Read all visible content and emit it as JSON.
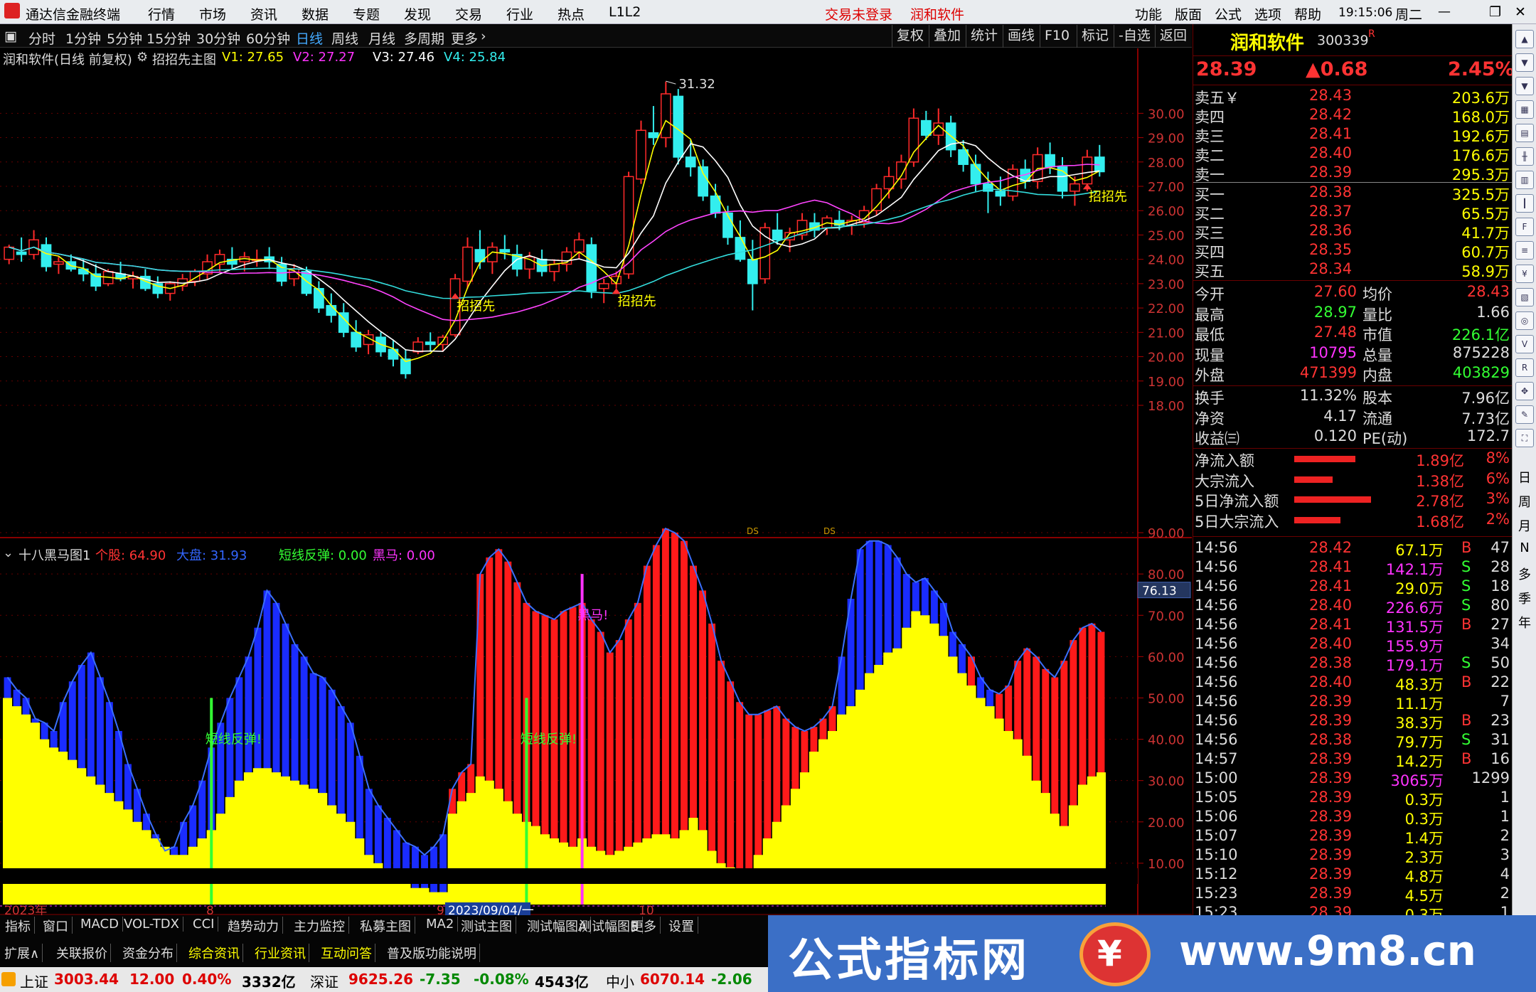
{
  "menubar": {
    "app_title": "通达信金融终端",
    "items": [
      "行情",
      "市场",
      "资讯",
      "数据",
      "专题",
      "发现",
      "交易",
      "行业",
      "热点",
      "L1L2"
    ],
    "login": "交易未登录",
    "broker": "润和软件",
    "right_items": [
      "功能",
      "版面",
      "公式",
      "选项",
      "帮助"
    ],
    "time": "19:15:06",
    "weekday": "周二"
  },
  "periodbar": {
    "items": [
      "分时",
      "1分钟",
      "5分钟",
      "15分钟",
      "30分钟",
      "60分钟",
      "日线",
      "周线",
      "月线",
      "多周期",
      "更多"
    ],
    "active": "日线",
    "tools": [
      "复权",
      "叠加",
      "统计",
      "画线",
      "F10",
      "标记",
      "-自选",
      "返回"
    ]
  },
  "main_legend": {
    "name": "润和软件(日线 前复权)",
    "indicator": "招招先主图",
    "v1": "V1: 27.65",
    "v2": "V2: 27.27",
    "v3": "V3: 27.46",
    "v4": "V4: 25.84"
  },
  "main_axis": [
    "30.00",
    "29.00",
    "28.00",
    "27.00",
    "26.00",
    "25.00",
    "24.00",
    "23.00",
    "22.00",
    "21.00",
    "20.00",
    "19.00",
    "18.00"
  ],
  "main_annotations": {
    "high_label": "31.32",
    "signal_label": "招招先"
  },
  "sub_legend": {
    "name": "十八黑马图1",
    "stock": "个股: 64.90",
    "market": "大盘: 31.93",
    "rebound": "短线反弹: 0.00",
    "darkhorse": "黑马: 0.00"
  },
  "sub_axis": [
    "90.00",
    "80.00",
    "70.00",
    "60.00",
    "50.00",
    "40.00",
    "30.00",
    "20.00",
    "10.00"
  ],
  "sub_marker": "76.13",
  "sub_annotations": {
    "rebound": "短线反弹!",
    "darkhorse": "黑马!"
  },
  "date_axis": {
    "y2023": "2023年",
    "m8": "8",
    "m9": "9",
    "crosshair": "2023/09/04/一",
    "m10": "10"
  },
  "chart_data": [
    {
      "type": "candlestick",
      "title": "润和软件(日线 前复权)",
      "ylim": [
        18,
        31.5
      ],
      "series_names": [
        "V1",
        "V2",
        "V3",
        "V4"
      ],
      "candles": [
        [
          24.0,
          24.6,
          23.8,
          24.5
        ],
        [
          24.3,
          24.9,
          23.9,
          24.2
        ],
        [
          24.2,
          25.2,
          24.0,
          24.8
        ],
        [
          24.6,
          24.9,
          23.5,
          23.7
        ],
        [
          23.8,
          24.1,
          23.4,
          23.9
        ],
        [
          23.9,
          24.2,
          23.5,
          23.6
        ],
        [
          23.6,
          24.0,
          23.1,
          23.4
        ],
        [
          23.4,
          23.8,
          22.7,
          22.9
        ],
        [
          23.0,
          23.6,
          22.9,
          23.5
        ],
        [
          23.4,
          23.9,
          23.1,
          23.2
        ],
        [
          23.2,
          23.5,
          22.8,
          23.3
        ],
        [
          23.3,
          23.6,
          22.7,
          22.8
        ],
        [
          23.0,
          23.3,
          22.4,
          22.6
        ],
        [
          22.6,
          23.1,
          22.3,
          23.0
        ],
        [
          22.9,
          23.4,
          22.7,
          23.2
        ],
        [
          23.1,
          23.6,
          22.9,
          23.5
        ],
        [
          23.4,
          24.2,
          23.2,
          23.9
        ],
        [
          23.8,
          24.4,
          23.5,
          24.2
        ],
        [
          24.0,
          24.5,
          23.6,
          23.8
        ],
        [
          23.9,
          24.3,
          23.5,
          24.1
        ],
        [
          24.0,
          24.4,
          23.7,
          24.0
        ],
        [
          24.1,
          24.5,
          23.6,
          23.9
        ],
        [
          23.8,
          24.1,
          22.9,
          23.1
        ],
        [
          23.2,
          23.8,
          22.9,
          23.6
        ],
        [
          23.5,
          23.7,
          22.5,
          22.6
        ],
        [
          22.8,
          23.1,
          21.8,
          22.0
        ],
        [
          22.1,
          22.6,
          21.4,
          21.7
        ],
        [
          21.8,
          22.2,
          20.8,
          21.0
        ],
        [
          21.0,
          21.5,
          20.2,
          20.4
        ],
        [
          20.5,
          21.1,
          20.1,
          20.9
        ],
        [
          20.8,
          21.0,
          20.0,
          20.2
        ],
        [
          20.3,
          20.7,
          19.6,
          19.9
        ],
        [
          19.9,
          20.3,
          19.1,
          19.3
        ],
        [
          20.2,
          20.8,
          20.1,
          20.6
        ],
        [
          20.6,
          21.0,
          20.2,
          20.5
        ],
        [
          20.5,
          20.9,
          20.2,
          20.8
        ],
        [
          20.9,
          23.4,
          20.8,
          23.2
        ],
        [
          23.1,
          24.9,
          22.8,
          24.5
        ],
        [
          24.4,
          25.2,
          23.6,
          23.9
        ],
        [
          23.9,
          24.7,
          23.4,
          24.5
        ],
        [
          24.4,
          25.0,
          24.0,
          24.3
        ],
        [
          24.2,
          24.6,
          23.3,
          23.6
        ],
        [
          23.6,
          24.3,
          23.2,
          24.1
        ],
        [
          24.0,
          24.4,
          23.3,
          23.5
        ],
        [
          23.5,
          24.0,
          23.1,
          23.8
        ],
        [
          23.8,
          24.5,
          23.5,
          24.3
        ],
        [
          24.3,
          25.1,
          24.0,
          24.8
        ],
        [
          24.6,
          24.9,
          22.4,
          22.7
        ],
        [
          22.8,
          23.2,
          22.2,
          23.0
        ],
        [
          23.0,
          23.5,
          22.8,
          23.3
        ],
        [
          23.4,
          27.6,
          23.2,
          27.4
        ],
        [
          27.3,
          29.7,
          27.1,
          29.3
        ],
        [
          29.2,
          30.3,
          28.7,
          29.0
        ],
        [
          29.0,
          31.3,
          28.6,
          30.8
        ],
        [
          30.7,
          31.0,
          27.9,
          28.2
        ],
        [
          28.2,
          28.9,
          27.4,
          27.8
        ],
        [
          27.8,
          28.1,
          26.4,
          26.6
        ],
        [
          26.6,
          27.1,
          25.7,
          25.9
        ],
        [
          25.9,
          26.2,
          24.6,
          24.9
        ],
        [
          24.9,
          25.6,
          23.9,
          24.0
        ],
        [
          24.0,
          24.8,
          21.9,
          23.0
        ],
        [
          23.2,
          25.5,
          23.0,
          25.3
        ],
        [
          25.2,
          25.9,
          24.6,
          24.8
        ],
        [
          24.8,
          25.3,
          24.3,
          25.1
        ],
        [
          25.0,
          25.9,
          24.8,
          25.6
        ],
        [
          25.5,
          25.9,
          24.9,
          25.2
        ],
        [
          25.3,
          25.8,
          25.0,
          25.7
        ],
        [
          25.6,
          26.0,
          25.2,
          25.4
        ],
        [
          25.4,
          25.8,
          25.0,
          25.6
        ],
        [
          25.5,
          26.2,
          25.3,
          26.0
        ],
        [
          26.0,
          27.1,
          25.8,
          26.9
        ],
        [
          26.9,
          27.8,
          26.5,
          27.4
        ],
        [
          27.3,
          28.3,
          26.9,
          28.0
        ],
        [
          28.0,
          30.2,
          27.8,
          29.8
        ],
        [
          29.7,
          30.1,
          28.9,
          29.1
        ],
        [
          29.1,
          30.2,
          28.7,
          29.6
        ],
        [
          29.6,
          29.9,
          28.2,
          28.5
        ],
        [
          28.5,
          28.9,
          27.6,
          27.9
        ],
        [
          27.9,
          28.3,
          26.8,
          27.1
        ],
        [
          27.1,
          27.6,
          25.9,
          26.8
        ],
        [
          26.8,
          27.4,
          26.2,
          26.6
        ],
        [
          26.6,
          27.9,
          26.4,
          27.7
        ],
        [
          27.7,
          28.1,
          26.9,
          27.2
        ],
        [
          27.2,
          28.6,
          26.9,
          28.3
        ],
        [
          28.3,
          28.8,
          27.5,
          27.8
        ],
        [
          27.8,
          28.2,
          26.5,
          26.8
        ],
        [
          26.8,
          27.4,
          26.2,
          27.1
        ],
        [
          27.1,
          28.5,
          26.8,
          28.2
        ],
        [
          28.2,
          28.7,
          27.4,
          27.6
        ]
      ],
      "V1": [
        27.65
      ],
      "V2": [
        27.27
      ],
      "V3": [
        27.46
      ],
      "V4": [
        25.84
      ],
      "annotations": [
        "31.32",
        "招招先",
        "招招先",
        "招招先"
      ]
    },
    {
      "type": "bar",
      "title": "十八黑马图1",
      "ylim": [
        0,
        95
      ],
      "series": [
        {
          "name": "个股",
          "values": [
            55,
            52,
            50,
            45,
            44,
            42,
            49,
            54,
            58,
            61,
            55,
            49,
            42,
            34,
            28,
            22,
            17,
            13,
            14,
            20,
            24,
            30,
            38,
            44,
            50,
            55,
            60,
            67,
            76,
            73,
            68,
            63,
            60,
            56,
            55,
            52,
            48,
            44,
            36,
            28,
            24,
            21,
            18,
            15,
            14,
            12,
            14,
            17,
            28,
            32,
            34,
            80,
            84,
            86,
            83,
            78,
            73,
            71,
            70,
            69,
            71,
            72,
            73,
            69,
            66,
            61,
            64,
            69,
            73,
            82,
            87,
            91,
            90,
            88,
            82,
            76,
            68,
            59,
            54,
            49,
            46,
            46,
            47,
            48,
            45,
            43,
            42,
            43,
            45,
            48,
            60,
            74,
            86,
            88,
            88,
            87,
            84,
            80,
            78,
            79,
            76,
            73,
            66,
            63,
            60,
            55,
            52,
            51,
            53,
            59,
            62,
            60,
            57,
            55,
            59,
            64,
            67,
            68,
            66
          ]
        },
        {
          "name": "大盘",
          "values": [
            50,
            48,
            46,
            44,
            40,
            38,
            37,
            35,
            33,
            31,
            29,
            27,
            25,
            23,
            20,
            18,
            16,
            14,
            12,
            12,
            14,
            16,
            18,
            22,
            26,
            30,
            32,
            33,
            33,
            32,
            31,
            30,
            29,
            28,
            27,
            24,
            22,
            20,
            16,
            12,
            10,
            8,
            6,
            5,
            4,
            4,
            3,
            3,
            22,
            25,
            27,
            31,
            30,
            28,
            25,
            22,
            20,
            19,
            17,
            16,
            15,
            14,
            16,
            14,
            13,
            12,
            13,
            14,
            15,
            16,
            17,
            17,
            16,
            18,
            21,
            18,
            13,
            10,
            9,
            8,
            8,
            12,
            16,
            20,
            24,
            28,
            32,
            37,
            40,
            42,
            46,
            48,
            52,
            56,
            58,
            61,
            62,
            67,
            71,
            70,
            68,
            65,
            60,
            56,
            53,
            50,
            48,
            45,
            42,
            40,
            36,
            30,
            27,
            22,
            19,
            24,
            29,
            31,
            32
          ]
        }
      ]
    }
  ],
  "quote": {
    "name": "润和软件",
    "code": "300339",
    "mark": "R",
    "price": "28.39",
    "change": "▲0.68",
    "pct": "2.45%",
    "asks": [
      {
        "label": "卖五￥",
        "price": "28.43",
        "vol": "203.6万"
      },
      {
        "label": "卖四",
        "price": "28.42",
        "vol": "168.0万"
      },
      {
        "label": "卖三",
        "price": "28.41",
        "vol": "192.6万"
      },
      {
        "label": "卖二",
        "price": "28.40",
        "vol": "176.6万"
      },
      {
        "label": "卖一",
        "price": "28.39",
        "vol": "295.3万"
      }
    ],
    "bids": [
      {
        "label": "买一",
        "price": "28.38",
        "vol": "325.5万"
      },
      {
        "label": "买二",
        "price": "28.37",
        "vol": "65.5万"
      },
      {
        "label": "买三",
        "price": "28.36",
        "vol": "41.7万"
      },
      {
        "label": "买四",
        "price": "28.35",
        "vol": "60.7万"
      },
      {
        "label": "买五",
        "price": "28.34",
        "vol": "58.9万"
      }
    ],
    "stats": [
      [
        "今开",
        "27.60",
        "均价",
        "28.43"
      ],
      [
        "最高",
        "28.97",
        "量比",
        "1.66"
      ],
      [
        "最低",
        "27.48",
        "市值",
        "226.1亿"
      ],
      [
        "现量",
        "10795",
        "总量",
        "875228"
      ],
      [
        "外盘",
        "471399",
        "内盘",
        "403829"
      ]
    ],
    "stats2": [
      [
        "换手",
        "11.32%",
        "股本",
        "7.96亿"
      ],
      [
        "净资",
        "4.17",
        "流通",
        "7.73亿"
      ],
      [
        "收益㈢",
        "0.120",
        "PE(动)",
        "172.7"
      ]
    ],
    "flows": [
      {
        "label": "净流入额",
        "value": "1.89亿",
        "pct": "8%",
        "bar": 0.8
      },
      {
        "label": "大宗流入",
        "value": "1.38亿",
        "pct": "6%",
        "bar": 0.5
      },
      {
        "label": "5日净流入额",
        "value": "2.78亿",
        "pct": "3%",
        "bar": 1.0
      },
      {
        "label": "5日大宗流入",
        "value": "1.68亿",
        "pct": "2%",
        "bar": 0.6
      }
    ],
    "ticks": [
      [
        "14:56",
        "28.42",
        "67.1万",
        "B",
        "47"
      ],
      [
        "14:56",
        "28.41",
        "142.1万",
        "S",
        "28"
      ],
      [
        "14:56",
        "28.41",
        "29.0万",
        "S",
        "18"
      ],
      [
        "14:56",
        "28.40",
        "226.6万",
        "S",
        "80"
      ],
      [
        "14:56",
        "28.41",
        "131.5万",
        "B",
        "27"
      ],
      [
        "14:56",
        "28.40",
        "155.9万",
        "",
        "34"
      ],
      [
        "14:56",
        "28.38",
        "179.1万",
        "S",
        "50"
      ],
      [
        "14:56",
        "28.40",
        "48.3万",
        "B",
        "22"
      ],
      [
        "14:56",
        "28.39",
        "11.1万",
        "",
        "7"
      ],
      [
        "14:56",
        "28.39",
        "38.3万",
        "B",
        "23"
      ],
      [
        "14:56",
        "28.38",
        "79.7万",
        "S",
        "31"
      ],
      [
        "14:57",
        "28.39",
        "14.2万",
        "B",
        "16"
      ],
      [
        "15:00",
        "28.39",
        "3065万",
        "",
        "1299"
      ],
      [
        "15:05",
        "28.39",
        "0.3万",
        "",
        "1"
      ],
      [
        "15:06",
        "28.39",
        "0.3万",
        "",
        "1"
      ],
      [
        "15:07",
        "28.39",
        "1.4万",
        "",
        "2"
      ],
      [
        "15:10",
        "28.39",
        "2.3万",
        "",
        "3"
      ],
      [
        "15:12",
        "28.39",
        "4.8万",
        "",
        "4"
      ],
      [
        "15:23",
        "28.39",
        "4.5万",
        "",
        "2"
      ],
      [
        "15:23",
        "28.39",
        "0.3万",
        "",
        "1"
      ]
    ]
  },
  "sidebar_text": [
    "日",
    "周",
    "月",
    "N",
    "多",
    "季",
    "年"
  ],
  "tabs": [
    "指标",
    "窗口",
    "MACD",
    "VOL-TDX",
    "CCI",
    "趋势动力",
    "主力监控",
    "私募主图",
    "MA2",
    "测试主图",
    "测试幅图A",
    "测试幅图B",
    "更多",
    "设置"
  ],
  "tabs2": [
    "扩展∧",
    "关联报价",
    "资金分布",
    "综合资讯",
    "行业资讯",
    "互动问答",
    "普及版功能说明"
  ],
  "status": {
    "sh_label": "上证",
    "sh": "3003.44",
    "sh_chg": "12.00",
    "sh_pct": "0.40%",
    "sh_amt": "3332亿",
    "sz_label": "深证",
    "sz": "9625.26",
    "sz_chg": "-7.35",
    "sz_pct": "-0.08%",
    "sz_amt": "4543亿",
    "zx_label": "中小",
    "zx": "6070.14",
    "zx_chg": "-2.06"
  },
  "watermark": {
    "cn": "公式指标网",
    "url": "www.9m8.cn"
  }
}
